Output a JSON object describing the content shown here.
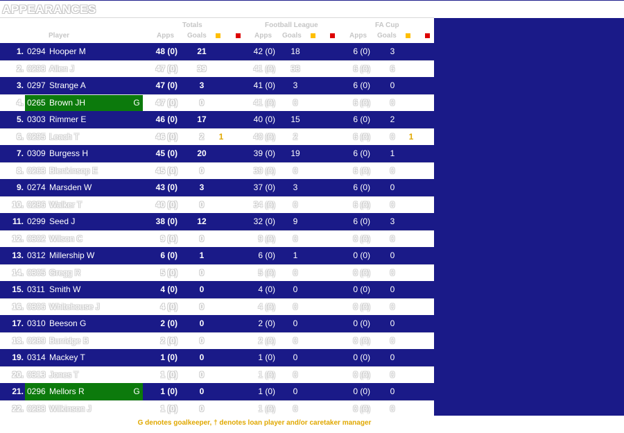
{
  "title": "APPEARANCES",
  "header": {
    "groups": [
      "Totals",
      "Football League",
      "FA Cup"
    ],
    "player": "Player",
    "apps": "Apps",
    "goals": "Goals"
  },
  "colors": {
    "odd_row": "#1a1a88",
    "goalkeeper": "#0c7a0c",
    "yellow_card": "#ffbf00",
    "red_card": "#dd0000"
  },
  "rows": [
    {
      "rank": "1.",
      "num": "0294",
      "name": "Hooper M",
      "gk": "",
      "t_apps": "48 (0)",
      "t_goals": "21",
      "t_y": "",
      "fl_apps": "42 (0)",
      "fl_goals": "18",
      "cup_apps": "6 (0)",
      "cup_goals": "3",
      "cup_y": ""
    },
    {
      "rank": "2.",
      "num": "0298",
      "name": "Allen J",
      "gk": "",
      "t_apps": "47 (0)",
      "t_goals": "39",
      "t_y": "",
      "fl_apps": "41 (0)",
      "fl_goals": "33",
      "cup_apps": "6 (0)",
      "cup_goals": "6",
      "cup_y": ""
    },
    {
      "rank": "3.",
      "num": "0297",
      "name": "Strange A",
      "gk": "",
      "t_apps": "47 (0)",
      "t_goals": "3",
      "t_y": "",
      "fl_apps": "41 (0)",
      "fl_goals": "3",
      "cup_apps": "6 (0)",
      "cup_goals": "0",
      "cup_y": ""
    },
    {
      "rank": "4.",
      "num": "0265",
      "name": "Brown JH",
      "gk": "G",
      "t_apps": "47 (0)",
      "t_goals": "0",
      "t_y": "",
      "fl_apps": "41 (0)",
      "fl_goals": "0",
      "cup_apps": "6 (0)",
      "cup_goals": "0",
      "cup_y": ""
    },
    {
      "rank": "5.",
      "num": "0303",
      "name": "Rimmer E",
      "gk": "",
      "t_apps": "46 (0)",
      "t_goals": "17",
      "t_y": "",
      "fl_apps": "40 (0)",
      "fl_goals": "15",
      "cup_apps": "6 (0)",
      "cup_goals": "2",
      "cup_y": ""
    },
    {
      "rank": "6.",
      "num": "0295",
      "name": "Leach T",
      "gk": "",
      "t_apps": "46 (0)",
      "t_goals": "2",
      "t_y": "1",
      "fl_apps": "40 (0)",
      "fl_goals": "2",
      "cup_apps": "6 (0)",
      "cup_goals": "0",
      "cup_y": "1"
    },
    {
      "rank": "7.",
      "num": "0309",
      "name": "Burgess H",
      "gk": "",
      "t_apps": "45 (0)",
      "t_goals": "20",
      "t_y": "",
      "fl_apps": "39 (0)",
      "fl_goals": "19",
      "cup_apps": "6 (0)",
      "cup_goals": "1",
      "cup_y": ""
    },
    {
      "rank": "8.",
      "num": "0263",
      "name": "Blenkinsop E",
      "gk": "",
      "t_apps": "45 (0)",
      "t_goals": "0",
      "t_y": "",
      "fl_apps": "39 (0)",
      "fl_goals": "0",
      "cup_apps": "6 (0)",
      "cup_goals": "0",
      "cup_y": ""
    },
    {
      "rank": "9.",
      "num": "0274",
      "name": "Marsden W",
      "gk": "",
      "t_apps": "43 (0)",
      "t_goals": "3",
      "t_y": "",
      "fl_apps": "37 (0)",
      "fl_goals": "3",
      "cup_apps": "6 (0)",
      "cup_goals": "0",
      "cup_y": ""
    },
    {
      "rank": "10.",
      "num": "0286",
      "name": "Walker T",
      "gk": "",
      "t_apps": "40 (0)",
      "t_goals": "0",
      "t_y": "",
      "fl_apps": "34 (0)",
      "fl_goals": "0",
      "cup_apps": "6 (0)",
      "cup_goals": "0",
      "cup_y": ""
    },
    {
      "rank": "11.",
      "num": "0299",
      "name": "Seed J",
      "gk": "",
      "t_apps": "38 (0)",
      "t_goals": "12",
      "t_y": "",
      "fl_apps": "32 (0)",
      "fl_goals": "9",
      "cup_apps": "6 (0)",
      "cup_goals": "3",
      "cup_y": ""
    },
    {
      "rank": "12.",
      "num": "0302",
      "name": "Wilson C",
      "gk": "",
      "t_apps": "9 (0)",
      "t_goals": "0",
      "t_y": "",
      "fl_apps": "9 (0)",
      "fl_goals": "0",
      "cup_apps": "0 (0)",
      "cup_goals": "0",
      "cup_y": ""
    },
    {
      "rank": "13.",
      "num": "0312",
      "name": "Millership W",
      "gk": "",
      "t_apps": "6 (0)",
      "t_goals": "1",
      "t_y": "",
      "fl_apps": "6 (0)",
      "fl_goals": "1",
      "cup_apps": "0 (0)",
      "cup_goals": "0",
      "cup_y": ""
    },
    {
      "rank": "14.",
      "num": "0305",
      "name": "Gregg R",
      "gk": "",
      "t_apps": "5 (0)",
      "t_goals": "0",
      "t_y": "",
      "fl_apps": "5 (0)",
      "fl_goals": "0",
      "cup_apps": "0 (0)",
      "cup_goals": "0",
      "cup_y": ""
    },
    {
      "rank": "15.",
      "num": "0311",
      "name": "Smith W",
      "gk": "",
      "t_apps": "4 (0)",
      "t_goals": "0",
      "t_y": "",
      "fl_apps": "4 (0)",
      "fl_goals": "0",
      "cup_apps": "0 (0)",
      "cup_goals": "0",
      "cup_y": ""
    },
    {
      "rank": "16.",
      "num": "0306",
      "name": "Whitehouse J",
      "gk": "",
      "t_apps": "4 (0)",
      "t_goals": "0",
      "t_y": "",
      "fl_apps": "4 (0)",
      "fl_goals": "0",
      "cup_apps": "0 (0)",
      "cup_goals": "0",
      "cup_y": ""
    },
    {
      "rank": "17.",
      "num": "0310",
      "name": "Beeson G",
      "gk": "",
      "t_apps": "2 (0)",
      "t_goals": "0",
      "t_y": "",
      "fl_apps": "2 (0)",
      "fl_goals": "0",
      "cup_apps": "0 (0)",
      "cup_goals": "0",
      "cup_y": ""
    },
    {
      "rank": "18.",
      "num": "0289",
      "name": "Burridge B",
      "gk": "",
      "t_apps": "2 (0)",
      "t_goals": "0",
      "t_y": "",
      "fl_apps": "2 (0)",
      "fl_goals": "0",
      "cup_apps": "0 (0)",
      "cup_goals": "0",
      "cup_y": ""
    },
    {
      "rank": "19.",
      "num": "0314",
      "name": "Mackey T",
      "gk": "",
      "t_apps": "1 (0)",
      "t_goals": "0",
      "t_y": "",
      "fl_apps": "1 (0)",
      "fl_goals": "0",
      "cup_apps": "0 (0)",
      "cup_goals": "0",
      "cup_y": ""
    },
    {
      "rank": "20.",
      "num": "0313",
      "name": "Jones T",
      "gk": "",
      "t_apps": "1 (0)",
      "t_goals": "0",
      "t_y": "",
      "fl_apps": "1 (0)",
      "fl_goals": "0",
      "cup_apps": "0 (0)",
      "cup_goals": "0",
      "cup_y": ""
    },
    {
      "rank": "21.",
      "num": "0296",
      "name": "Mellors R",
      "gk": "G",
      "t_apps": "1 (0)",
      "t_goals": "0",
      "t_y": "",
      "fl_apps": "1 (0)",
      "fl_goals": "0",
      "cup_apps": "0 (0)",
      "cup_goals": "0",
      "cup_y": ""
    },
    {
      "rank": "22.",
      "num": "0288",
      "name": "Wilkinson J",
      "gk": "",
      "t_apps": "1 (0)",
      "t_goals": "0",
      "t_y": "",
      "fl_apps": "1 (0)",
      "fl_goals": "0",
      "cup_apps": "0 (0)",
      "cup_goals": "0",
      "cup_y": ""
    }
  ],
  "footnote": "G denotes goalkeeper, † denotes loan player and/or caretaker manager"
}
